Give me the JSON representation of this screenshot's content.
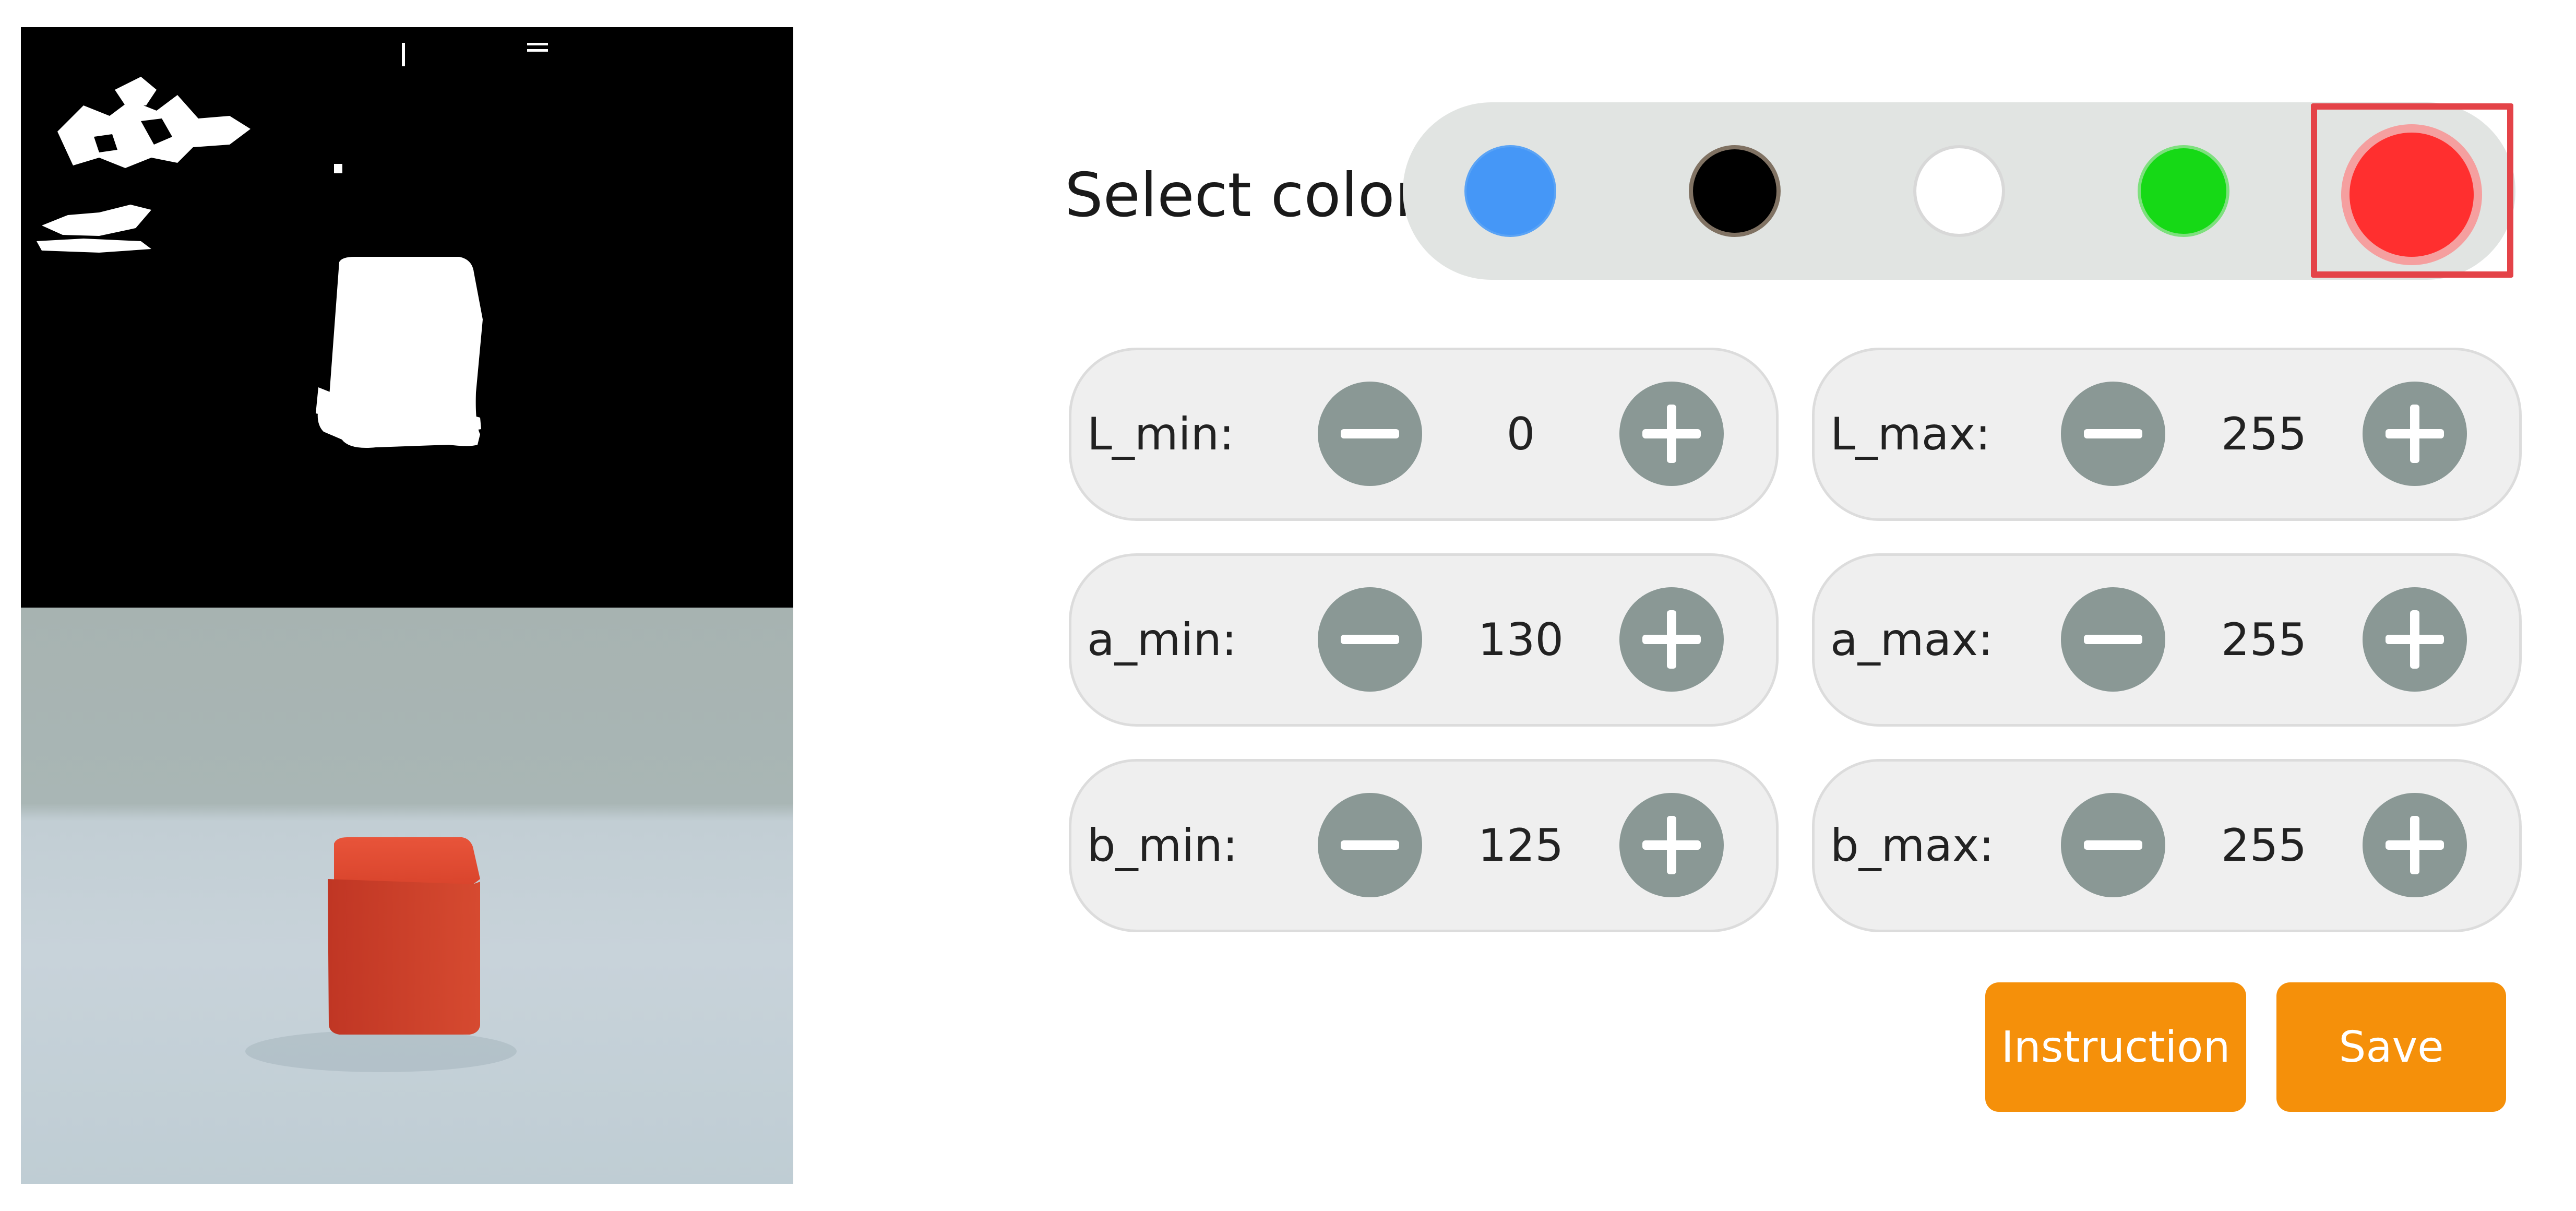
{
  "color_selector": {
    "label": "Select color:",
    "swatches": [
      {
        "name": "blue",
        "hex": "#4597f7"
      },
      {
        "name": "black",
        "hex": "#000000"
      },
      {
        "name": "white",
        "hex": "#ffffff"
      },
      {
        "name": "green",
        "hex": "#16d916"
      },
      {
        "name": "red",
        "hex": "#ff2f2f",
        "selected": true
      }
    ]
  },
  "thresholds": {
    "L_min": {
      "label": "L_min:",
      "value": "0"
    },
    "L_max": {
      "label": "L_max:",
      "value": "255"
    },
    "a_min": {
      "label": "a_min:",
      "value": "130"
    },
    "a_max": {
      "label": "a_max:",
      "value": "255"
    },
    "b_min": {
      "label": "b_min:",
      "value": "125"
    },
    "b_max": {
      "label": "b_max:",
      "value": "255"
    }
  },
  "actions": {
    "instruction_label": "Instruction",
    "save_label": "Save"
  },
  "colors": {
    "accent_orange": "#f5900a",
    "stepper_button": "#8a9895",
    "selection_frame": "#e44348",
    "color_bar_bg": "#e1e4e2",
    "panel_bg": "#efefef"
  },
  "icons": {
    "decrement": "minus-icon",
    "increment": "plus-icon"
  }
}
